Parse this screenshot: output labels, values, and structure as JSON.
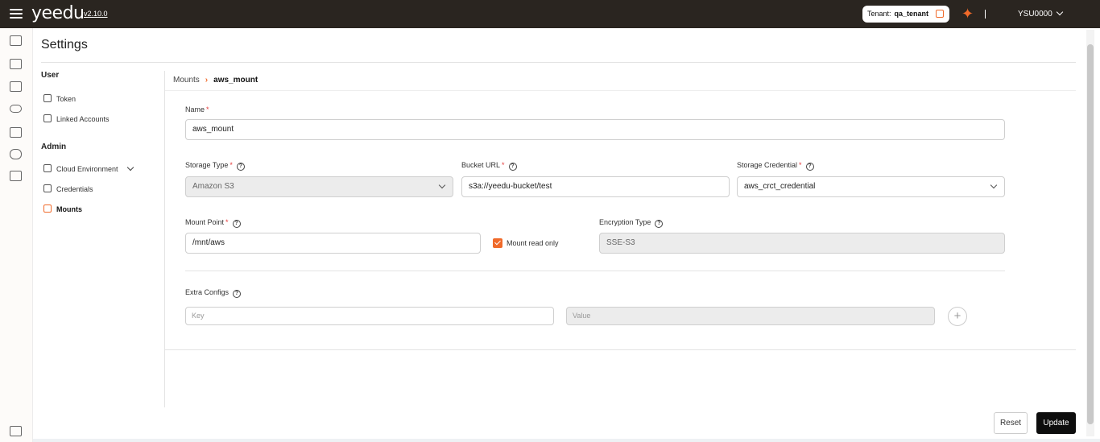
{
  "header": {
    "logo": "yeedu",
    "version": "v2.10.0",
    "tenant_label": "Tenant:",
    "tenant_value": "qa_tenant",
    "user": "YSU0000"
  },
  "page": {
    "title": "Settings"
  },
  "sidebar": {
    "user_section": "User",
    "user_items": [
      {
        "label": "Token"
      },
      {
        "label": "Linked Accounts"
      }
    ],
    "admin_section": "Admin",
    "admin_items": [
      {
        "label": "Cloud Environment"
      },
      {
        "label": "Credentials"
      },
      {
        "label": "Mounts"
      }
    ]
  },
  "breadcrumb": {
    "parent": "Mounts",
    "current": "aws_mount"
  },
  "form": {
    "name_label": "Name",
    "name_value": "aws_mount",
    "storage_type_label": "Storage Type",
    "storage_type_value": "Amazon S3",
    "bucket_url_label": "Bucket URL",
    "bucket_url_value": "s3a://yeedu-bucket/test",
    "storage_credential_label": "Storage Credential",
    "storage_credential_value": "aws_crct_credential",
    "mount_point_label": "Mount Point",
    "mount_point_value": "/mnt/aws",
    "read_only_label": "Mount read only",
    "read_only_checked": true,
    "encryption_type_label": "Encryption Type",
    "encryption_type_value": "SSE-S3",
    "extra_configs_label": "Extra Configs",
    "key_placeholder": "Key",
    "value_placeholder": "Value"
  },
  "actions": {
    "reset": "Reset",
    "update": "Update"
  },
  "colors": {
    "accent": "#f06a2a",
    "topbar": "#2a2520",
    "primary_button": "#0d0d0d"
  }
}
